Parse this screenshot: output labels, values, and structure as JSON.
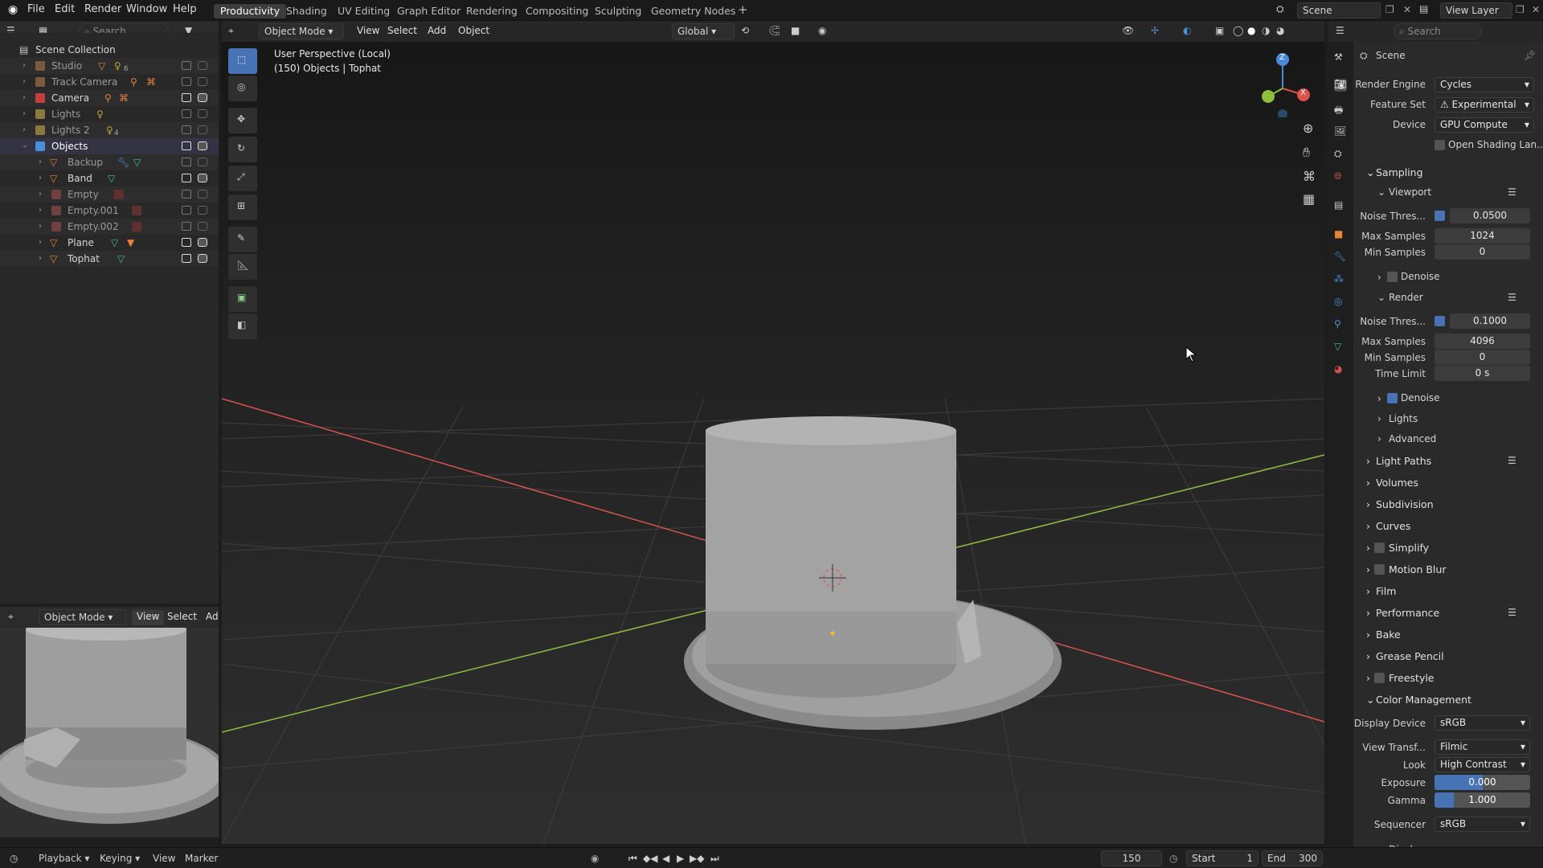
{
  "topbar": {
    "menus": [
      "File",
      "Edit",
      "Render",
      "Window",
      "Help"
    ],
    "workspaces": [
      "Productivity",
      "Shading",
      "UV Editing",
      "Graph Editor",
      "Rendering",
      "Compositing",
      "Sculpting",
      "Geometry Nodes"
    ],
    "active_workspace": "Productivity",
    "add_tab": "+",
    "scene": "Scene",
    "view_layer": "View Layer",
    "search_placeholder": "Search"
  },
  "outliner": {
    "search_placeholder": "Search",
    "root": "Scene Collection",
    "items": [
      {
        "label": "Studio",
        "color": "#c08050",
        "count": "6"
      },
      {
        "label": "Track Camera",
        "color": "#c08050"
      },
      {
        "label": "Camera",
        "color": "#d04040"
      },
      {
        "label": "Lights",
        "color": "#c0a040"
      },
      {
        "label": "Lights 2",
        "color": "#c0a040",
        "count": "4"
      },
      {
        "label": "Objects",
        "color": "#4a90d9"
      },
      {
        "label": "Backup",
        "color": "#e8843a"
      },
      {
        "label": "Band",
        "color": "#e8843a"
      },
      {
        "label": "Empty",
        "color": "#a05050"
      },
      {
        "label": "Empty.001",
        "color": "#a05050"
      },
      {
        "label": "Empty.002",
        "color": "#a05050"
      },
      {
        "label": "Plane",
        "color": "#e8843a"
      },
      {
        "label": "Tophat",
        "color": "#e8843a"
      }
    ]
  },
  "preview": {
    "mode": "Object Mode",
    "menus": [
      "View",
      "Select",
      "Ad"
    ]
  },
  "viewport": {
    "mode": "Object Mode",
    "menus": [
      "View",
      "Select",
      "Add",
      "Object"
    ],
    "orientation": "Global",
    "info_line1": "User Perspective (Local)",
    "info_line2": "(150) Objects | Tophat",
    "gizmo": {
      "z": "Z",
      "x": "X",
      "y": "Y"
    }
  },
  "properties": {
    "search_placeholder": "Search",
    "context": "Scene",
    "render_engine_label": "Render Engine",
    "render_engine": "Cycles",
    "feature_set_label": "Feature Set",
    "feature_set": "Experimental",
    "device_label": "Device",
    "device": "GPU Compute",
    "osl_label": "Open Shading Lan...",
    "sampling": "Sampling",
    "viewport_sub": "Viewport",
    "noise_label": "Noise Thres...",
    "vp_noise": "0.0500",
    "max_samples_label": "Max Samples",
    "vp_max": "1024",
    "min_samples_label": "Min Samples",
    "vp_min": "0",
    "denoise": "Denoise",
    "render_sub": "Render",
    "r_noise": "0.1000",
    "r_max": "4096",
    "r_min": "0",
    "time_limit_label": "Time Limit",
    "time_limit": "0 s",
    "lights": "Lights",
    "advanced": "Advanced",
    "sections": [
      "Light Paths",
      "Volumes",
      "Subdivision",
      "Curves",
      "Simplify",
      "Motion Blur",
      "Film",
      "Performance",
      "Bake",
      "Grease Pencil",
      "Freestyle"
    ],
    "color_mgmt": "Color Management",
    "display_device_label": "Display Device",
    "display_device": "sRGB",
    "view_transform_label": "View Transf...",
    "view_transform": "Filmic",
    "look_label": "Look",
    "look": "High Contrast",
    "exposure_label": "Exposure",
    "exposure": "0.000",
    "gamma_label": "Gamma",
    "gamma": "1.000",
    "sequencer_label": "Sequencer",
    "sequencer": "sRGB",
    "display": "Display"
  },
  "timeline": {
    "menus": [
      "Playback",
      "Keying",
      "View",
      "Marker"
    ],
    "current_frame": "150",
    "start_label": "Start",
    "start": "1",
    "end_label": "End",
    "end": "300"
  },
  "colors": {
    "accent": "#4772b3",
    "x_axis": "#d9534f",
    "y_axis": "#8fbf3f",
    "z_axis": "#4a8ad9"
  }
}
